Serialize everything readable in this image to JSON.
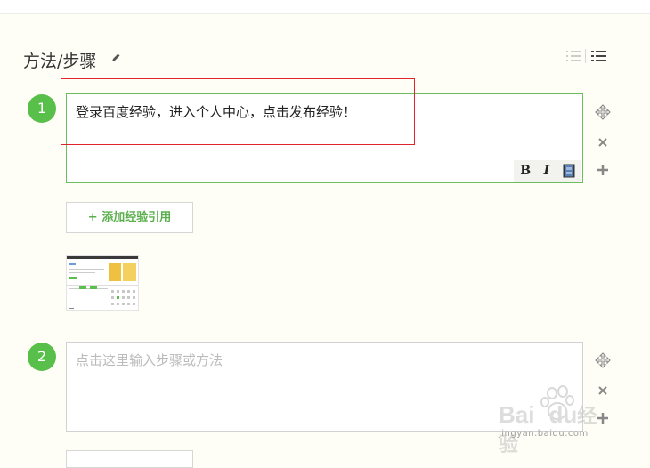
{
  "section": {
    "title": "方法/步骤"
  },
  "steps": [
    {
      "number": "1",
      "text": "登录百度经验，进入个人中心，点击发布经验！"
    },
    {
      "number": "2",
      "placeholder": "点击这里输入步骤或方法"
    }
  ],
  "toolbar": {
    "bold_label": "B",
    "italic_label": "I"
  },
  "add_reference": {
    "label": "+ 添加经验引用"
  },
  "watermark": {
    "brand": "Bai",
    "brand_suffix": "du",
    "cn": "经验",
    "url": "jingyan.baidu.com"
  },
  "colors": {
    "accent_green": "#58c04a",
    "highlight_red": "#e0242b",
    "background": "#fefef6"
  },
  "icons": [
    "pencil-icon",
    "numbered-list-icon",
    "bullet-list-icon",
    "move-icon",
    "close-icon",
    "plus-icon",
    "video-icon"
  ]
}
